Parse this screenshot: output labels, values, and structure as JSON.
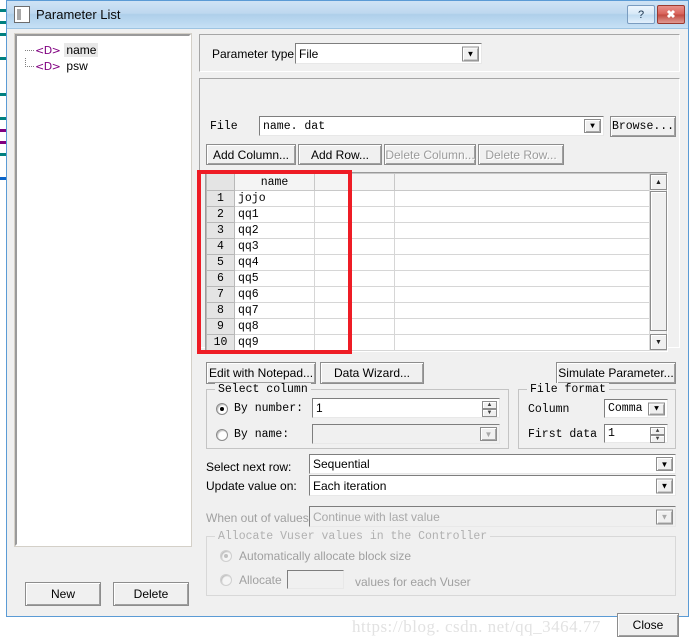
{
  "window": {
    "title": "Parameter List",
    "icon": "document-icon",
    "help_button": "?",
    "close_button": "✖"
  },
  "tree": {
    "items": [
      {
        "label": "name",
        "icon": "<D>",
        "selected": true
      },
      {
        "label": "psw",
        "icon": "<D>",
        "selected": false
      }
    ],
    "new_label": "New",
    "delete_label": "Delete"
  },
  "parameter_type": {
    "label": "Parameter type:",
    "value": "File"
  },
  "file": {
    "label": "File",
    "value": "name. dat",
    "browse_label": "Browse..."
  },
  "table_buttons": {
    "add_column": "Add Column...",
    "add_row": "Add Row...",
    "delete_column": "Delete Column...",
    "delete_row": "Delete Row..."
  },
  "grid": {
    "columns": [
      "name",
      ""
    ],
    "rows": [
      {
        "num": "1",
        "name": "jojo"
      },
      {
        "num": "2",
        "name": "qq1"
      },
      {
        "num": "3",
        "name": "qq2"
      },
      {
        "num": "4",
        "name": "qq3"
      },
      {
        "num": "5",
        "name": "qq4"
      },
      {
        "num": "6",
        "name": "qq5"
      },
      {
        "num": "7",
        "name": "qq6"
      },
      {
        "num": "8",
        "name": "qq7"
      },
      {
        "num": "9",
        "name": "qq8"
      },
      {
        "num": "10",
        "name": "qq9"
      }
    ]
  },
  "tool_buttons": {
    "edit_with_notepad": "Edit with Notepad...",
    "data_wizard": "Data Wizard...",
    "simulate_parameter": "Simulate Parameter..."
  },
  "select_column": {
    "title": "Select column",
    "by_number_label": "By number:",
    "by_number_value": "1",
    "by_name_label": "By name:",
    "by_name_value": ""
  },
  "file_format": {
    "title": "File format",
    "column_label": "Column",
    "column_value": "Comma",
    "first_data_label": "First data",
    "first_data_value": "1"
  },
  "row_options": {
    "select_next_row_label": "Select next row:",
    "select_next_row_value": "Sequential",
    "update_value_on_label": "Update value on:",
    "update_value_on_value": "Each iteration",
    "when_out_of_values_label": "When out of values:",
    "when_out_of_values_value": "Continue with last value"
  },
  "allocate": {
    "title": "Allocate Vuser values in the Controller",
    "auto_label": "Automatically allocate block size",
    "allocate_label": "Allocate",
    "allocate_value": "",
    "allocate_suffix": "values for each Vuser"
  },
  "footer": {
    "close_label": "Close",
    "watermark": "https://blog. csdn. net/qq_3464.77"
  },
  "annotation": {
    "color": "#ee1c25",
    "target": "parameter-value-table"
  }
}
